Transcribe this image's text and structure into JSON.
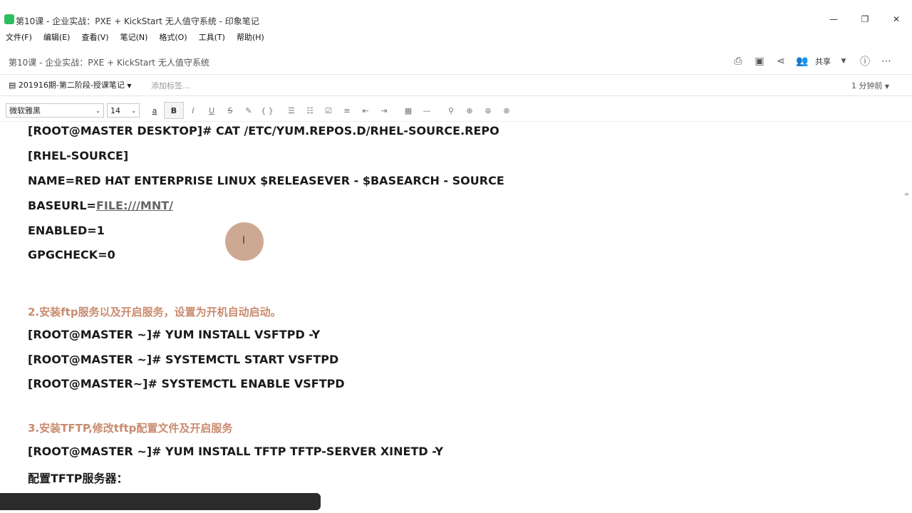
{
  "window": {
    "title": "第10课 - 企业实战：PXE + KickStart 无人值守系统 - 印象笔记",
    "controls": {
      "minimize": "—",
      "restore": "❐",
      "close": "✕"
    }
  },
  "menu": {
    "items": [
      "文件(F)",
      "编辑(E)",
      "查看(V)",
      "笔记(N)",
      "格式(O)",
      "工具(T)",
      "帮助(H)"
    ]
  },
  "note": {
    "title": "第10课 - 企业实战：PXE + KickStart 无人值守系统",
    "notebook": "201916期-第二阶段-授课笔记",
    "tag_placeholder": "添加标签...",
    "reminder": "1 分钟前",
    "share_label": "共享"
  },
  "format_bar": {
    "font": "微软雅黑",
    "size": "14",
    "buttons": [
      "a",
      "B",
      "I",
      "U",
      "S",
      "✎",
      "{ }",
      "☰",
      "☷",
      "☑",
      "≡",
      "⇤",
      "⇥",
      "▦",
      "—",
      "⚲",
      "⊕",
      "⊛",
      "⊗"
    ]
  },
  "content": {
    "lines": [
      "[ROOT@MASTER DESKTOP]# CAT  /ETC/YUM.REPOS.D/RHEL-SOURCE.REPO",
      "[RHEL-SOURCE]",
      "NAME=RED HAT ENTERPRISE LINUX $RELEASEVER - $BASEARCH - SOURCE",
      "BASEURL=",
      "FILE:///MNT/",
      "ENABLED=1",
      "GPGCHECK=0",
      "2.安装ftp服务以及开启服务，设置为开机自动启动。",
      "[ROOT@MASTER ~]# YUM INSTALL VSFTPD -Y",
      "[ROOT@MASTER ~]# SYSTEMCTL START VSFTPD",
      "[ROOT@MASTER~]# SYSTEMCTL ENABLE VSFTPD",
      "3.安装TFTP,修改tftp配置文件及开启服务",
      "[ROOT@MASTER ~]# YUM INSTALL TFTP TFTP-SERVER XINETD -Y",
      "配置TFTP服务器："
    ]
  },
  "colors": {
    "heading": "#c98b6f",
    "accent": "#2dbe60"
  },
  "icons": [
    "printer-icon",
    "present-icon",
    "share-icon",
    "user-group-icon",
    "info-icon",
    "more-icon",
    "notebook-icon",
    "bold-icon",
    "italic-icon",
    "underline-icon",
    "strikethrough-icon",
    "highlight-icon",
    "code-icon",
    "bullet-list-icon",
    "number-list-icon",
    "checkbox-icon",
    "align-icon",
    "outdent-icon",
    "indent-icon",
    "table-icon",
    "divider-icon",
    "link-icon",
    "attachment-icon",
    "record-icon",
    "clear-format-icon"
  ]
}
